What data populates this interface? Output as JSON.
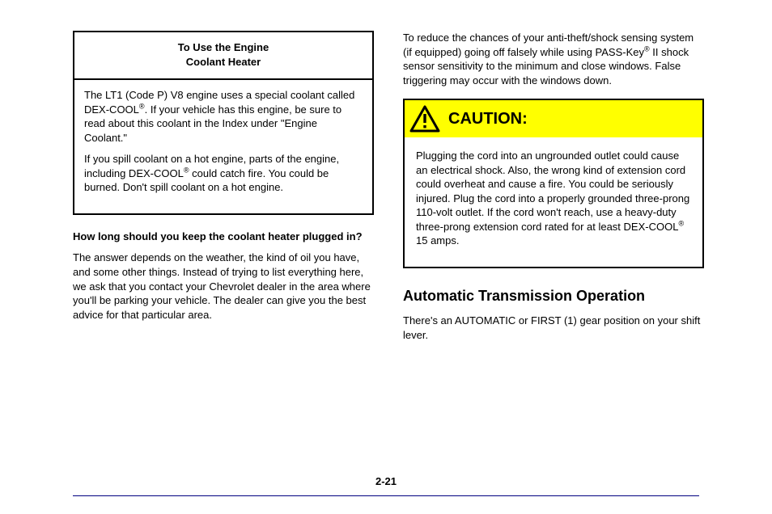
{
  "left_box": {
    "header1": "To Use the Engine",
    "header2": "Coolant Heater",
    "body1_pre": "The LT1 (Code P) V8 engine uses a special coolant called DEX-COOL",
    "body1_post": ". If your vehicle has this engine, be sure to read about this coolant in the Index under \"Engine Coolant.\"",
    "body2_pre": "If you spill coolant on a hot engine, parts of the engine, including DEX-COOL",
    "body2_post": " could catch fire. You could be burned. Don't spill coolant on a hot engine."
  },
  "left_text": {
    "q_title": "How long should you keep the coolant heater plugged in?",
    "q_p1": "The answer depends on the weather, the kind of oil you have, and some other things. Instead of trying to list everything here, we ask that you contact your Chevrolet dealer in the area where you'll be parking your vehicle. The dealer can give you the best advice for that particular area."
  },
  "right_text_above": {
    "p1_pre": "To reduce the chances of your anti-theft/shock sensing system (if equipped) going off falsely while using PASS-Key",
    "p1_post": " II shock sensor sensitivity to the minimum and close windows. False triggering may occur with the windows down."
  },
  "caution": {
    "label": "CAUTION:",
    "body_pre": "Plugging the cord into an ungrounded outlet could cause an electrical shock. Also, the wrong kind of extension cord could overheat and cause a fire. You could be seriously injured. Plug the cord into a properly grounded three-prong 110-volt outlet. If the cord won't reach, use a heavy-duty three-prong extension cord rated for at least DEX-COOL",
    "body_post": " 15 amps."
  },
  "big_title": "Automatic Transmission Operation",
  "para_below": "There's an AUTOMATIC or FIRST (1) gear position on your shift lever.",
  "footer": {
    "page_no": "2-21"
  }
}
